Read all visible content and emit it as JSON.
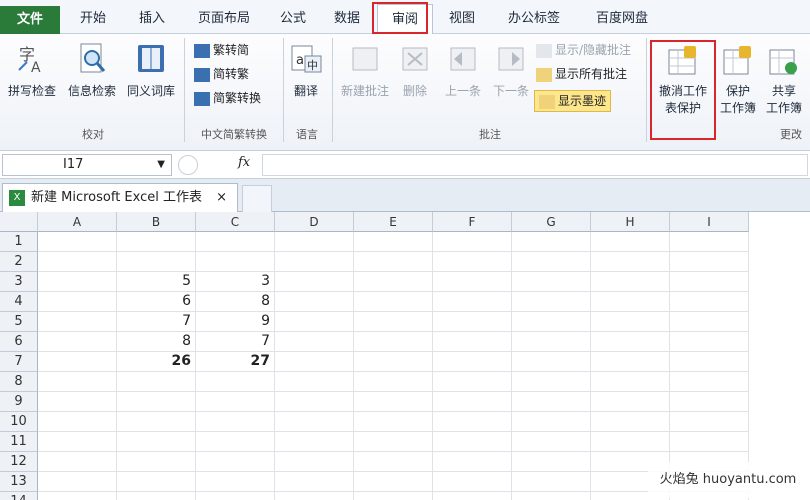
{
  "menu": {
    "tabs": [
      "文件",
      "开始",
      "插入",
      "页面布局",
      "公式",
      "数据",
      "审阅",
      "视图",
      "办公标签",
      "百度网盘"
    ],
    "active": "审阅"
  },
  "ribbon": {
    "proofing": {
      "label": "校对",
      "buttons": [
        "拼写检查",
        "信息检索",
        "同义词库"
      ]
    },
    "chinese": {
      "label": "中文简繁转换",
      "buttons": [
        "繁转简",
        "简转繁",
        "简繁转换"
      ]
    },
    "language": {
      "label": "语言",
      "button": "翻译"
    },
    "comments": {
      "label": "批注",
      "buttons": [
        "新建批注",
        "删除",
        "上一条",
        "下一条"
      ],
      "show_hide": "显示/隐藏批注",
      "show_all": "显示所有批注",
      "show_ink": "显示墨迹"
    },
    "changes": {
      "label": "更改",
      "unprotect_line1": "撤消工作",
      "unprotect_line2": "表保护",
      "protect_wb_line1": "保护",
      "protect_wb_line2": "工作簿",
      "share_line1": "共享",
      "share_line2": "工作簿"
    }
  },
  "formula_bar": {
    "name_box": "I17",
    "fx": "fx",
    "value": ""
  },
  "workbook": {
    "tab_title": "新建 Microsoft Excel 工作表",
    "close": "×"
  },
  "sheet": {
    "columns": [
      "A",
      "B",
      "C",
      "D",
      "E",
      "F",
      "G",
      "H",
      "I"
    ],
    "rows": [
      "1",
      "2",
      "3",
      "4",
      "5",
      "6",
      "7",
      "8",
      "9",
      "10",
      "11",
      "12",
      "13",
      "14"
    ],
    "cells": [
      {
        "row": 3,
        "col": "B",
        "value": "5",
        "bold": false
      },
      {
        "row": 3,
        "col": "C",
        "value": "3",
        "bold": false
      },
      {
        "row": 4,
        "col": "B",
        "value": "6",
        "bold": false
      },
      {
        "row": 4,
        "col": "C",
        "value": "8",
        "bold": false
      },
      {
        "row": 5,
        "col": "B",
        "value": "7",
        "bold": false
      },
      {
        "row": 5,
        "col": "C",
        "value": "9",
        "bold": false
      },
      {
        "row": 6,
        "col": "B",
        "value": "8",
        "bold": false
      },
      {
        "row": 6,
        "col": "C",
        "value": "7",
        "bold": false
      },
      {
        "row": 7,
        "col": "B",
        "value": "26",
        "bold": true
      },
      {
        "row": 7,
        "col": "C",
        "value": "27",
        "bold": true
      }
    ]
  },
  "watermark": "火焰兔 huoyantu.com",
  "colors": {
    "file_tab": "#2a7a3a",
    "highlight": "#d9262c",
    "ink_button": "#fde78c"
  }
}
